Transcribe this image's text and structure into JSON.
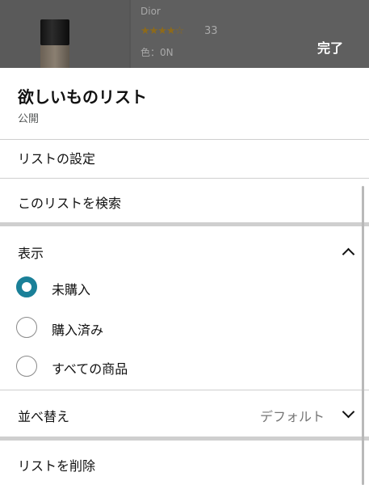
{
  "background_product": {
    "brand": "Dior",
    "stars": "★★★★☆",
    "rating_count": "33",
    "variant": "色：0N",
    "done_label": "完了"
  },
  "sheet": {
    "title": "欲しいものリスト",
    "visibility": "公開",
    "settings_label": "リストの設定",
    "search_label": "このリストを検索",
    "display": {
      "header": "表示",
      "options": [
        {
          "label": "未購入",
          "selected": true
        },
        {
          "label": "購入済み",
          "selected": false
        },
        {
          "label": "すべての商品",
          "selected": false
        }
      ]
    },
    "sort": {
      "label": "並べ替え",
      "value": "デフォルト"
    },
    "delete_label": "リストを削除"
  },
  "colors": {
    "accent": "#1a8098",
    "backdrop": "#5f5f5f",
    "divider": "#cfcfcf"
  }
}
